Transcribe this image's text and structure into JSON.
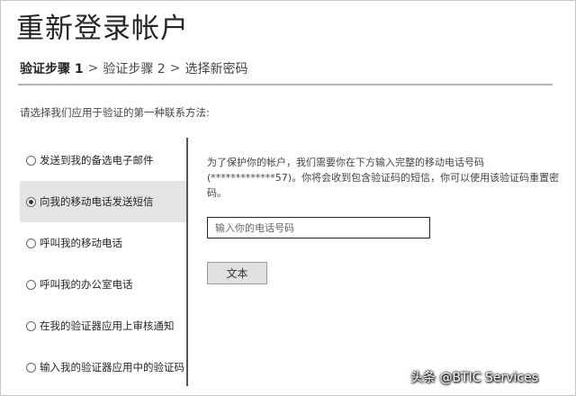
{
  "page": {
    "title": "重新登录帐户"
  },
  "steps": {
    "current": "验证步骤 1",
    "step2": "验证步骤 2",
    "step3": "选择新密码",
    "separator": ">"
  },
  "instruction": "请选择我们应用于验证的第一种联系方法:",
  "methods": [
    {
      "label": "发送到我的备选电子邮件",
      "selected": false
    },
    {
      "label": "向我的移动电话发送短信",
      "selected": true
    },
    {
      "label": "呼叫我的移动电话",
      "selected": false
    },
    {
      "label": "呼叫我的办公室电话",
      "selected": false
    },
    {
      "label": "在我的验证器应用上审核通知",
      "selected": false
    },
    {
      "label": "输入我的验证器应用中的验证码",
      "selected": false
    }
  ],
  "detail": {
    "line1": "为了保护你的帐户，我们需要你在下方输入完整的移动电话号码",
    "line2": "(*************57)。你将会收到包含验证码的短信，你可以使用该验证码重置密码。"
  },
  "phone_input": {
    "placeholder": "输入你的电话号码",
    "value": ""
  },
  "submit_button": {
    "label": "文本"
  },
  "watermark": "头条 @BTIC Services",
  "colors": {
    "selected_bg": "#e4e4e4",
    "divider": "#555555",
    "button_bg": "#e0e0e0"
  }
}
